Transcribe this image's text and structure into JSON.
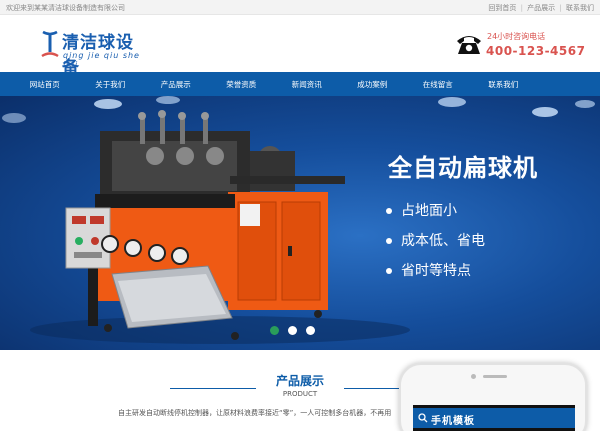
{
  "topbar": {
    "welcome": "欢迎来到某某清洁球设备制造有限公司",
    "links": [
      "回到首页",
      "产品展示",
      "联系我们"
    ],
    "separator": "|"
  },
  "header": {
    "logo_text": "清洁球设备",
    "logo_pinyin": "qing jie qiu she bei",
    "hotline_label": "24小时咨询电话",
    "hotline_number": "400-123-4567",
    "brand_color": "#1a5fb0",
    "hotline_color": "#d9534f"
  },
  "nav": {
    "items": [
      "网站首页",
      "关于我们",
      "产品展示",
      "荣誉资质",
      "新闻资讯",
      "成功案例",
      "在线留言",
      "联系我们"
    ],
    "background": "#0d5ca8"
  },
  "banner": {
    "title": "全自动扁球机",
    "features": [
      "占地面小",
      "成本低、省电",
      "省时等特点"
    ],
    "slide_count": 3,
    "active_slide": 1,
    "active_dot_color": "#2a9d5a"
  },
  "products": {
    "title": "产品展示",
    "subtitle": "PRODUCT",
    "description": "自主研发自动断线停机控制器，让原材料浪费率接近“零”，一人可控制多台机器，不再用",
    "accent": "#0d5ca8"
  },
  "mobile": {
    "title": "手机模板"
  }
}
